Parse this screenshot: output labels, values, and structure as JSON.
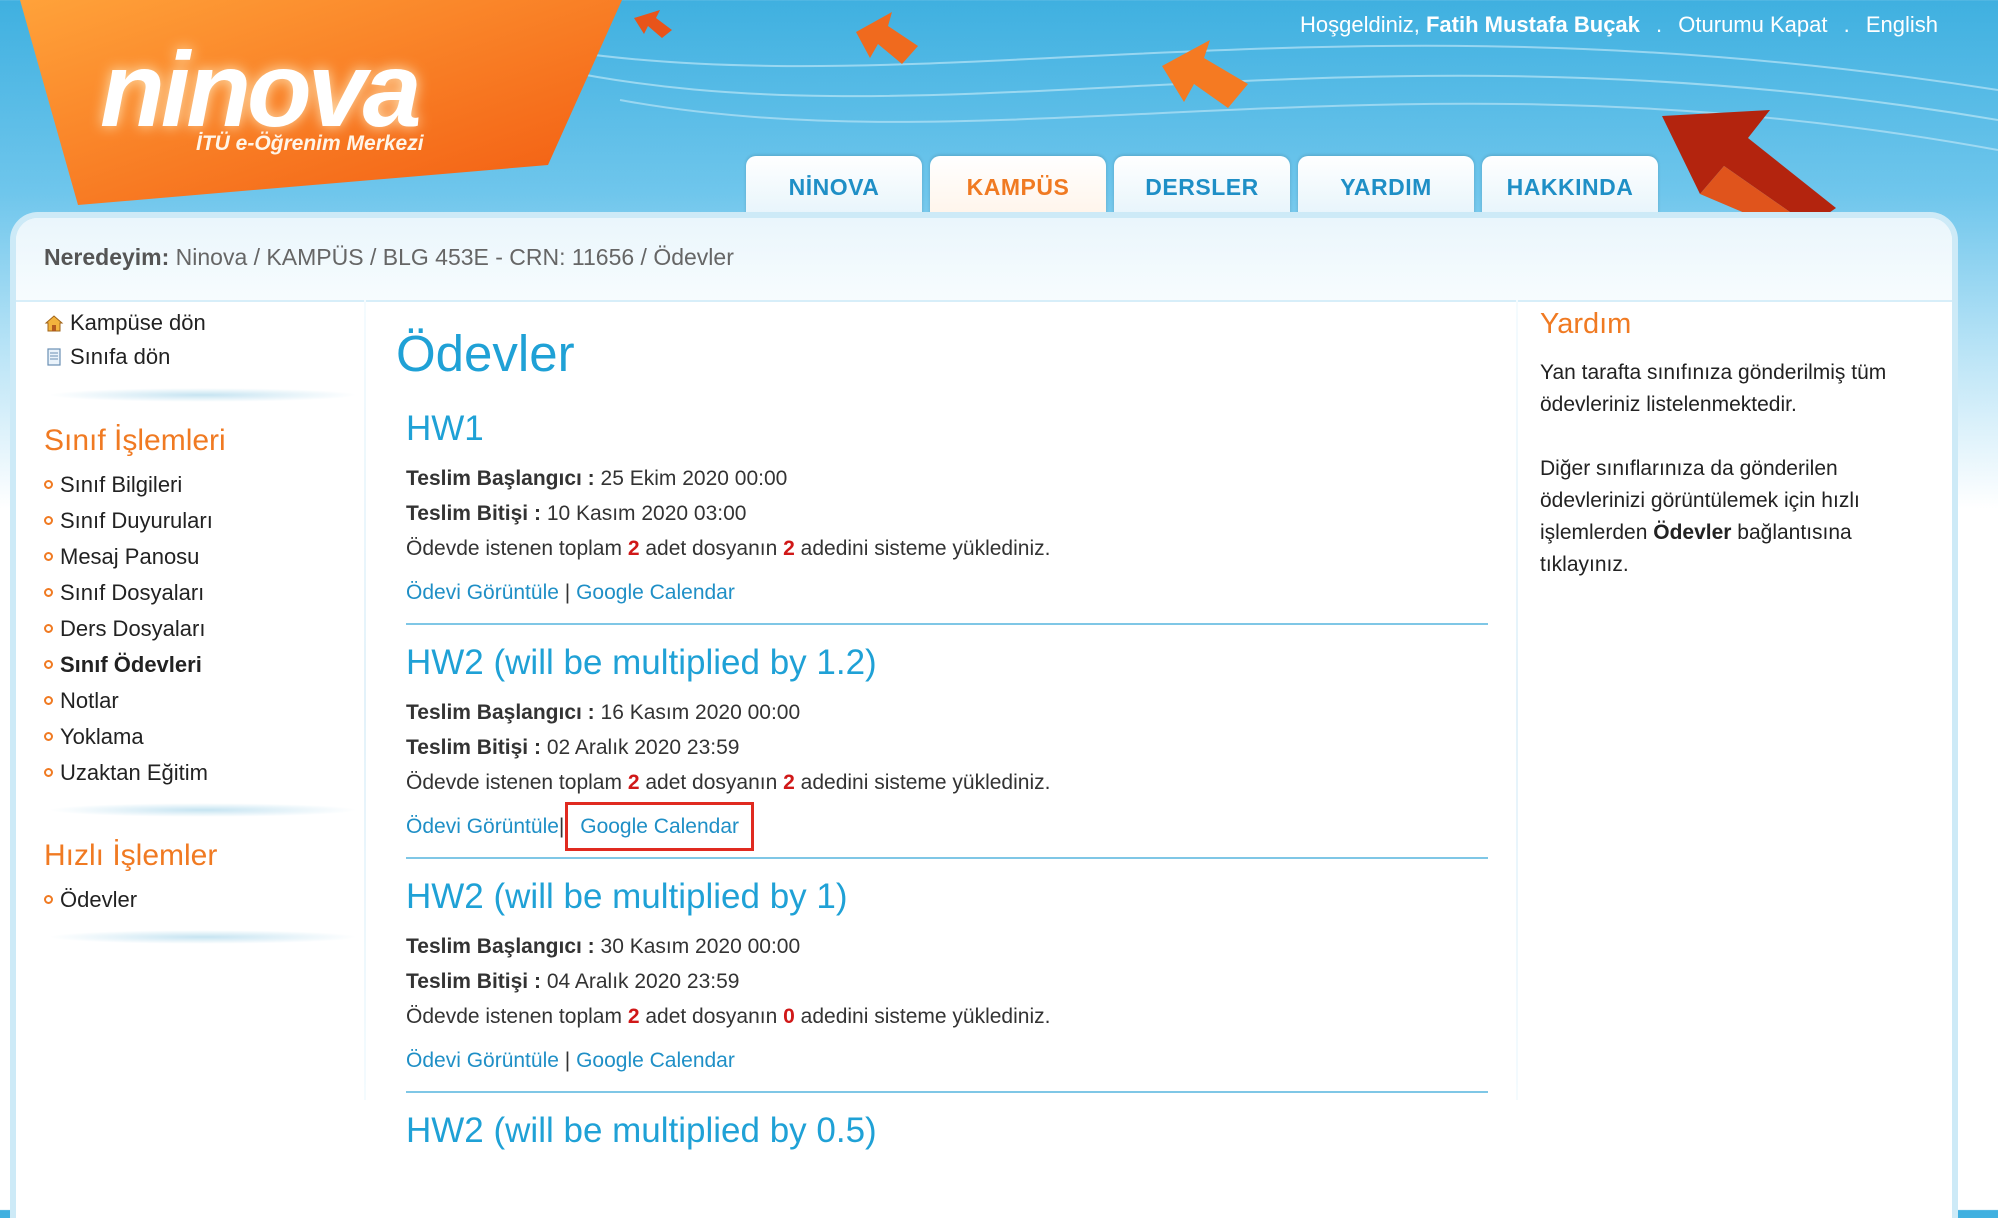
{
  "header": {
    "logo": "ninova",
    "logo_sub": "İTÜ e-Öğrenim Merkezi",
    "welcome_prefix": "Hoşgeldiniz,",
    "user_name": "Fatih Mustafa Buçak",
    "logout": "Oturumu Kapat",
    "language": "English"
  },
  "tabs": [
    {
      "label": "NİNOVA"
    },
    {
      "label": "KAMPÜS",
      "active": true
    },
    {
      "label": "DERSLER"
    },
    {
      "label": "YARDIM"
    },
    {
      "label": "HAKKINDA"
    }
  ],
  "breadcrumb": {
    "prefix": "Neredeyim:",
    "path": "Ninova / KAMPÜS / BLG 453E - CRN: 11656 / Ödevler"
  },
  "sidebar": {
    "nav": [
      {
        "label": "Kampüse dön",
        "icon": "home-icon"
      },
      {
        "label": "Sınıfa dön",
        "icon": "class-icon"
      }
    ],
    "class_ops_title": "Sınıf İşlemleri",
    "class_ops": [
      "Sınıf Bilgileri",
      "Sınıf Duyuruları",
      "Mesaj Panosu",
      "Sınıf Dosyaları",
      "Ders Dosyaları",
      "Sınıf Ödevleri",
      "Notlar",
      "Yoklama",
      "Uzaktan Eğitim"
    ],
    "quick_ops_title": "Hızlı İşlemler",
    "quick_ops": [
      "Ödevler"
    ]
  },
  "main": {
    "title": "Ödevler",
    "labels": {
      "start": "Teslim Başlangıcı :",
      "end": "Teslim Bitişi :",
      "upload_a": "Ödevde istenen toplam",
      "upload_b": "adet dosyanın",
      "upload_c": "adedini sisteme yüklediniz.",
      "view": "Ödevi Görüntüle",
      "pipe": "|",
      "calendar": "Google Calendar"
    },
    "homeworks": [
      {
        "title": "HW1",
        "start": "25 Ekim 2020 00:00",
        "end": "10 Kasım 2020 03:00",
        "total": "2",
        "uploaded": "2"
      },
      {
        "title": "HW2 (will be multiplied by 1.2)",
        "start": "16 Kasım 2020 00:00",
        "end": "02 Aralık 2020 23:59",
        "total": "2",
        "uploaded": "2"
      },
      {
        "title": "HW2 (will be multiplied by 1)",
        "start": "30 Kasım 2020 00:00",
        "end": "04 Aralık 2020 23:59",
        "total": "2",
        "uploaded": "0"
      },
      {
        "title": "HW2 (will be multiplied by 0.5)"
      }
    ]
  },
  "help": {
    "title": "Yardım",
    "p1": "Yan tarafta sınıfınıza gönderilmiş tüm ödevleriniz listelenmektedir.",
    "p2_a": "Diğer sınıflarınıza da gönderilen ödevlerinizi görüntülemek için hızlı işlemlerden",
    "p2_b": "Ödevler",
    "p2_c": "bağlantısına tıklayınız."
  },
  "colors": {
    "accent_blue": "#1fa1d6",
    "accent_orange": "#f07a22",
    "highlight_red": "#e02a20"
  }
}
